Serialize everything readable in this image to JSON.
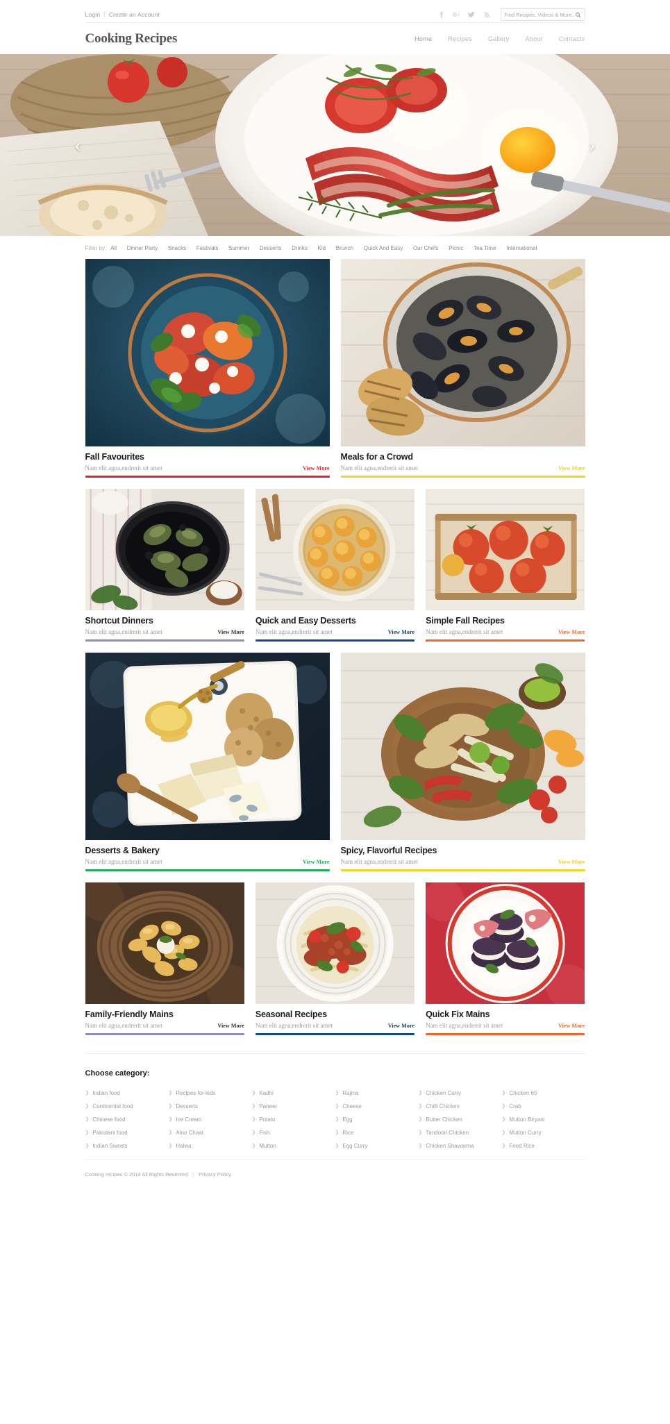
{
  "topbar": {
    "login": "Login",
    "separator": "|",
    "create_account": "Create an Account",
    "social": [
      "facebook-icon",
      "google-plus-icon",
      "twitter-icon",
      "rss-icon"
    ]
  },
  "search": {
    "placeholder": "Find Recipes, Videos & More...",
    "value": "",
    "icon": "search-icon"
  },
  "header": {
    "logo": "Cooking Recipes",
    "nav": [
      {
        "label": "Home",
        "active": true
      },
      {
        "label": "Recipes",
        "active": false
      },
      {
        "label": "Gallery",
        "active": false
      },
      {
        "label": "About",
        "active": false
      },
      {
        "label": "Contacts",
        "active": false
      }
    ]
  },
  "hero": {
    "prev_label": "‹",
    "next_label": "›",
    "alt": "Breakfast plate with fried egg, bacon, grilled tomatoes and bread"
  },
  "filter": {
    "label": "Filter by:",
    "items": [
      "All",
      "Dinner Party",
      "Snacks",
      "Festivals",
      "Summer",
      "Desserts",
      "Drinks",
      "Kid",
      "Brunch",
      "Quick And Easy",
      "Our Chefs",
      "Picnic",
      "Tea Time",
      "International"
    ]
  },
  "cards": [
    {
      "title": "Fall Favourites",
      "subtitle": "Nam elit agna,endrerit sit amet",
      "link": "View More",
      "color": "#e1232b",
      "size": "w2",
      "art": "tomato-mozzarella-plate"
    },
    {
      "title": "Meals for a Crowd",
      "subtitle": "Nam elit agna,endrerit sit amet",
      "link": "View More",
      "color": "#f2d425",
      "size": "w2",
      "art": "mussels-pot"
    },
    {
      "title": "Shortcut Dinners",
      "subtitle": "Nam elit agna,endrerit sit amet",
      "link": "View More",
      "color": "#8f8bc4",
      "size": "w3",
      "art": "artichoke-skillet"
    },
    {
      "title": "Quick and Easy Desserts",
      "subtitle": "Nam elit agna,endrerit sit amet",
      "link": "View More",
      "color": "#164a86",
      "size": "w3",
      "art": "apricot-tart"
    },
    {
      "title": "Simple Fall Recipes",
      "subtitle": "Nam elit agna,endrerit sit amet",
      "link": "View More",
      "color": "#f2682a",
      "size": "w3",
      "art": "tomato-crate"
    },
    {
      "title": "Desserts & Bakery",
      "subtitle": "Nam elit agna,endrerit sit amet",
      "link": "View More",
      "color": "#1faa5c",
      "size": "w2",
      "art": "cheese-honey-board"
    },
    {
      "title": "Spicy, Flavorful Recipes",
      "subtitle": "Nam elit agna,endrerit sit amet",
      "link": "View More",
      "color": "#f2d425",
      "size": "w2",
      "art": "spice-bowl"
    },
    {
      "title": "Family-Friendly Mains",
      "subtitle": "Nam elit agna,endrerit sit amet",
      "link": "View More",
      "color": "#8f8bc4",
      "size": "w3",
      "art": "rigatoni-bowl"
    },
    {
      "title": "Seasonal Recipes",
      "subtitle": "Nam elit agna,endrerit sit amet",
      "link": "View More",
      "color": "#164a86",
      "size": "w3",
      "art": "pasta-bolognese"
    },
    {
      "title": "Quick Fix Mains",
      "subtitle": "Nam elit agna,endrerit sit amet",
      "link": "View More",
      "color": "#f2682a",
      "size": "w3",
      "art": "eggplant-stack"
    }
  ],
  "categories": {
    "heading": "Choose category:",
    "columns": [
      [
        "Indian food",
        "Continental food",
        "Chinese food",
        "Pakistani food",
        "Indian Sweets"
      ],
      [
        "Recipes for kids",
        "Desserts",
        "Ice Cream",
        "Aloo Chaat",
        "Halwa"
      ],
      [
        "Kadhi",
        "Paneer",
        "Potato",
        "Fish",
        "Mutton"
      ],
      [
        "Rajma",
        "Cheese",
        "Egg",
        "Rice",
        "Egg Curry"
      ],
      [
        "Chicken Curry",
        "Chilli Chicken",
        "Butter Chicken",
        "Tandoori Chicken",
        "Chicken Shawarma"
      ],
      [
        "Chicken 65",
        "Crab",
        "Mutton Biryani",
        "Mutton Curry",
        "Fried Rice"
      ]
    ]
  },
  "footer": {
    "copyright": "Cooking recipes © 2014 All Rights Reserved",
    "separator": "|",
    "privacy": "Privacy Policy"
  }
}
